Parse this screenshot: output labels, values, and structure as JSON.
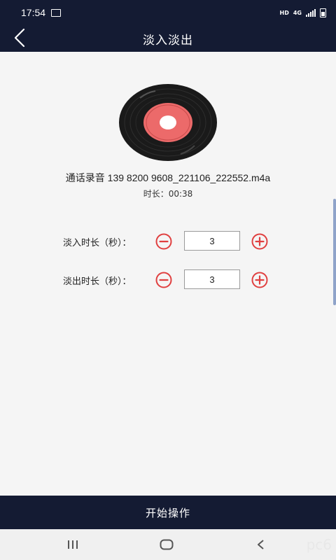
{
  "status_bar": {
    "time": "17:54",
    "hd_label": "HD",
    "network_label": "4G"
  },
  "app_bar": {
    "title": "淡入淡出"
  },
  "file": {
    "name": "通话录音 139 8200 9608_221106_222552.m4a",
    "duration": "时长：00:38"
  },
  "fade_in": {
    "label": "淡入时长（秒）：",
    "value": "3"
  },
  "fade_out": {
    "label": "淡出时长（秒）：",
    "value": "3"
  },
  "start_button": {
    "label": "开始操作"
  },
  "watermark": "pc6",
  "colors": {
    "bar_bg": "#141b33",
    "accent_red": "#e04040",
    "record_label": "#ec6a6a",
    "page_bg": "#f5f5f5"
  },
  "icons": {
    "back": "back-chevron-icon",
    "minus": "minus-circle-icon",
    "plus": "plus-circle-icon",
    "nav_recent": "recent-apps-icon",
    "nav_home": "home-icon",
    "nav_back": "nav-back-icon"
  }
}
